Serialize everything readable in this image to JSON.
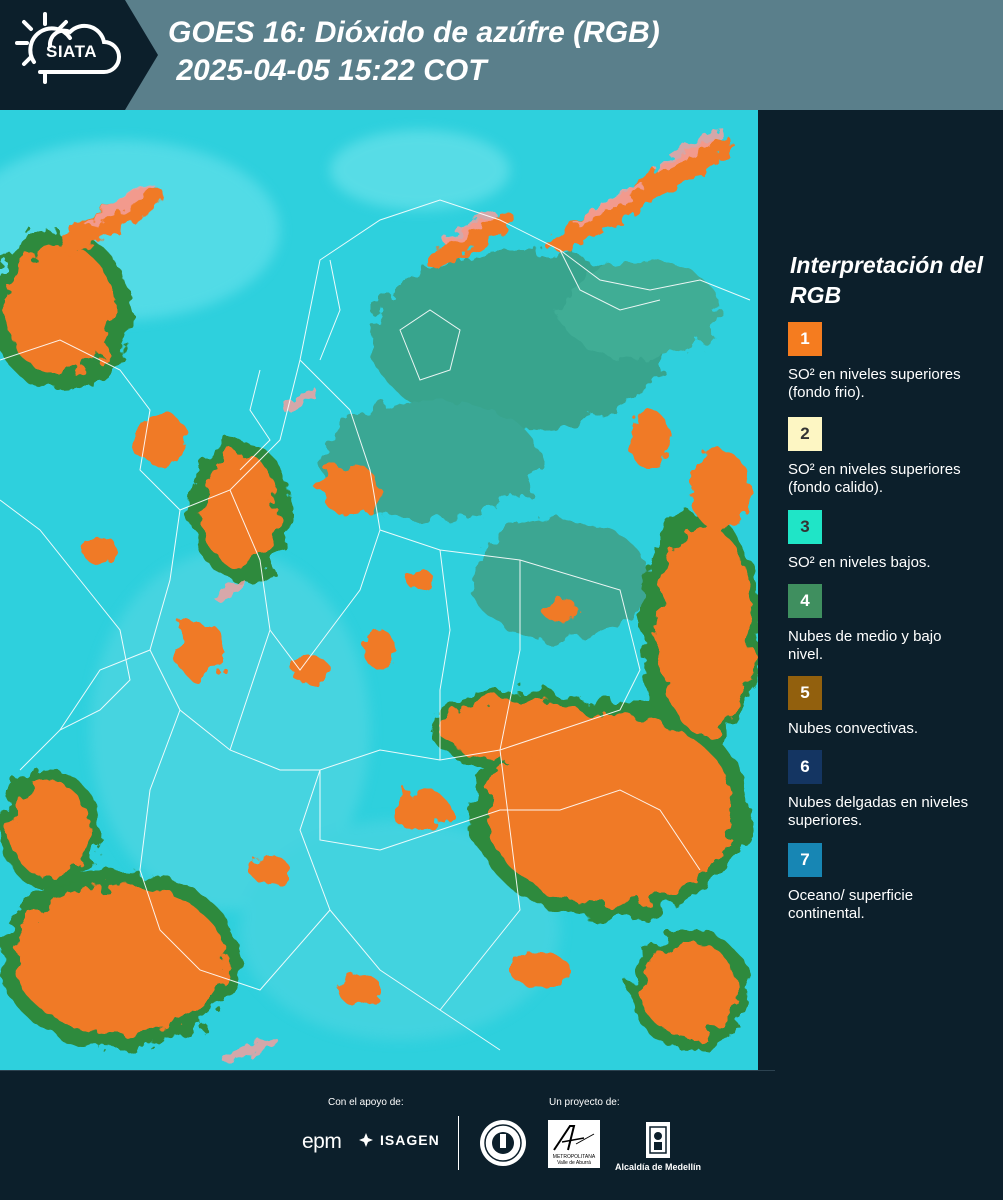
{
  "header": {
    "logo_text": "SIATA",
    "title_line1": "GOES 16: Dióxido de azúfre (RGB)",
    "title_line2": " 2025-04-05 15:22 COT"
  },
  "legend": {
    "title": "Interpretación del RGB",
    "items": [
      {
        "number": "1",
        "color": "#f57c1f",
        "text": "SO² en niveles superiores (fondo frio)."
      },
      {
        "number": "2",
        "color": "#fdf6c3",
        "text": "SO² en niveles superiores (fondo calido)."
      },
      {
        "number": "3",
        "color": "#1fe5c7",
        "text": "SO² en niveles bajos."
      },
      {
        "number": "4",
        "color": "#3f8f5f",
        "text": "Nubes de medio y bajo nivel."
      },
      {
        "number": "5",
        "color": "#92600d",
        "text": "Nubes convectivas."
      },
      {
        "number": "6",
        "color": "#143562",
        "text": "Nubes delgadas en niveles superiores."
      },
      {
        "number": "7",
        "color": "#1786b4",
        "text": "Oceano/ superficie continental."
      }
    ]
  },
  "footer": {
    "support_label": "Con el apoyo de:",
    "project_label": "Un proyecto de:",
    "epm_logo": "epm",
    "isagen_logo": "ISAGEN",
    "area_logo_text": "METROPOLITANA Valle de Aburrá",
    "alcaldia_label": "Alcaldía de Medellín"
  },
  "colors": {
    "background": "#0c1f2b",
    "header": "#5a7f8b",
    "map_base": "#2bd3df"
  }
}
